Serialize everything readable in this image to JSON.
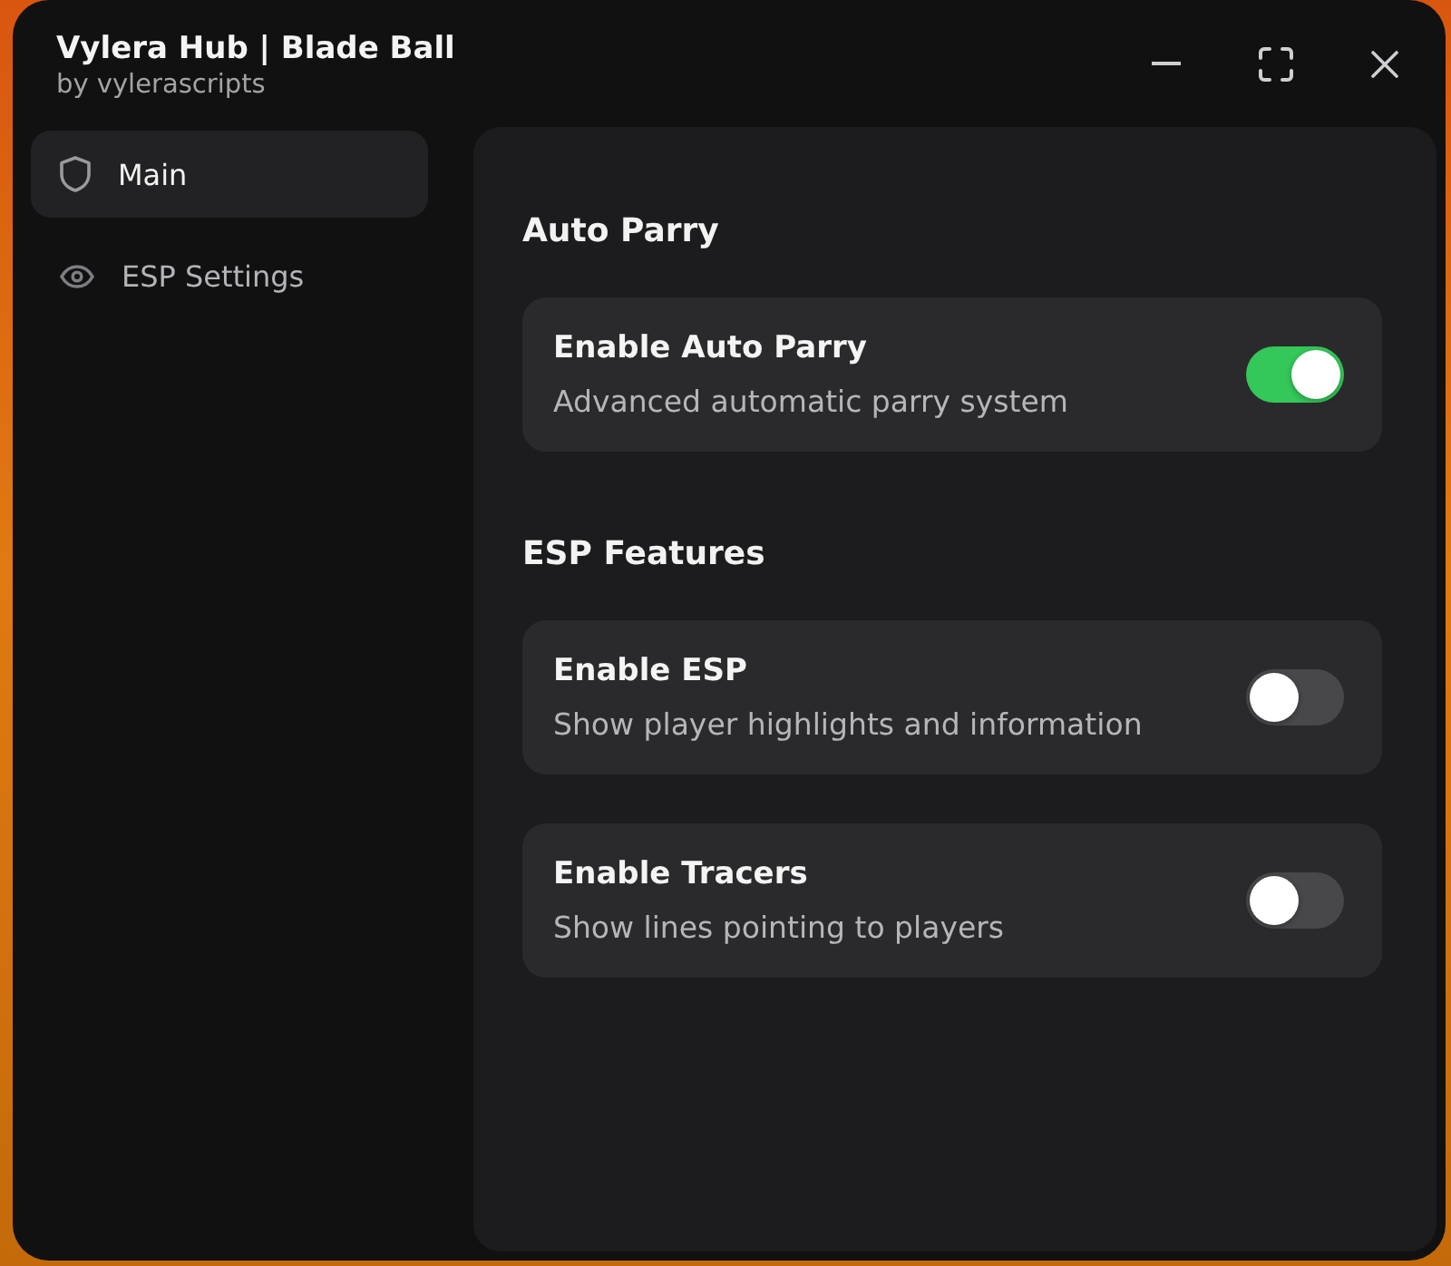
{
  "window": {
    "title": "Vylera Hub | Blade Ball",
    "subtitle": "by vylerascripts"
  },
  "sidebar": {
    "items": [
      {
        "label": "Main",
        "selected": true
      },
      {
        "label": "ESP Settings",
        "selected": false
      }
    ]
  },
  "sections": [
    {
      "heading": "Auto Parry",
      "options": [
        {
          "title": "Enable Auto Parry",
          "description": "Advanced automatic parry system",
          "on": true
        }
      ]
    },
    {
      "heading": "ESP Features",
      "options": [
        {
          "title": "Enable ESP",
          "description": "Show player highlights and information",
          "on": false
        },
        {
          "title": "Enable Tracers",
          "description": "Show lines pointing to players",
          "on": false
        }
      ]
    }
  ]
}
